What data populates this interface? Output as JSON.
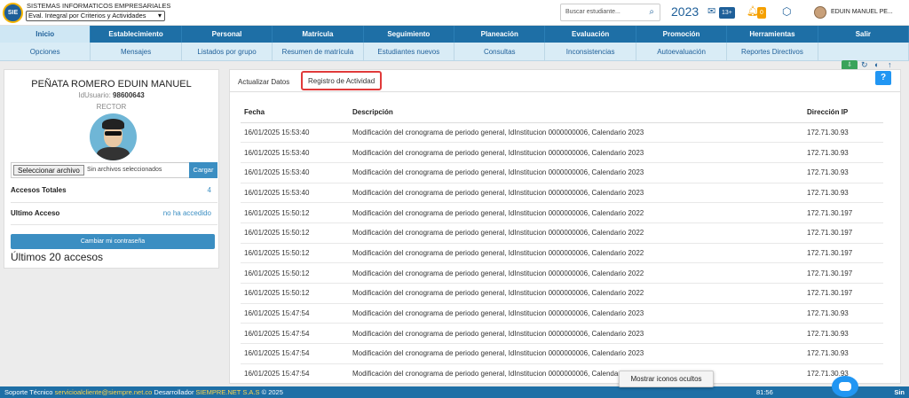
{
  "header": {
    "company": "SISTEMAS INFORMATICOS EMPRESARIALES",
    "logo_text": "SIE",
    "module": "Eval. Integral por Criterios y Actividades",
    "search_placeholder": "Buscar estudiante...",
    "year": "2023",
    "messages_badge": "13+",
    "notifications_badge": "0",
    "user": "EDUIN MANUEL PE..."
  },
  "nav_main": [
    "Inicio",
    "Establecimiento",
    "Personal",
    "Matrícula",
    "Seguimiento",
    "Planeación",
    "Evaluación",
    "Promoción",
    "Herramientas",
    "Salir"
  ],
  "nav_sub": [
    "Opciones",
    "Mensajes",
    "Listados por grupo",
    "Resumen de matrícula",
    "Estudiantes nuevos",
    "Consultas",
    "Inconsistencias",
    "Autoevaluación",
    "Reportes Directivos",
    ""
  ],
  "profile": {
    "name": "PEÑATA ROMERO EDUIN MANUEL",
    "id_label": "IdUsuario:",
    "id_value": "98600643",
    "role": "RECTOR",
    "file_button": "Seleccionar archivo",
    "file_text": "Sin archivos seleccionados",
    "upload_button": "Cargar",
    "total_label": "Accesos Totales",
    "total_value": "4",
    "last_label": "Ultimo Acceso",
    "last_value": "no ha accedido",
    "change_password": "Cambiar mi contraseña",
    "last_accesses": "Últimos 20 accesos"
  },
  "tabs": {
    "update": "Actualizar Datos",
    "activity": "Registro de Actividad"
  },
  "help_label": "?",
  "table": {
    "headers": [
      "Fecha",
      "Descripción",
      "Dirección IP"
    ],
    "rows": [
      [
        "16/01/2025 15:53:40",
        "Modificación del cronograma de periodo general, IdInstitucion 0000000006, Calendario 2023",
        "172.71.30.93"
      ],
      [
        "16/01/2025 15:53:40",
        "Modificación del cronograma de periodo general, IdInstitucion 0000000006, Calendario 2023",
        "172.71.30.93"
      ],
      [
        "16/01/2025 15:53:40",
        "Modificación del cronograma de periodo general, IdInstitucion 0000000006, Calendario 2023",
        "172.71.30.93"
      ],
      [
        "16/01/2025 15:53:40",
        "Modificación del cronograma de periodo general, IdInstitucion 0000000006, Calendario 2023",
        "172.71.30.93"
      ],
      [
        "16/01/2025 15:50:12",
        "Modificación del cronograma de periodo general, IdInstitucion 0000000006, Calendario 2022",
        "172.71.30.197"
      ],
      [
        "16/01/2025 15:50:12",
        "Modificación del cronograma de periodo general, IdInstitucion 0000000006, Calendario 2022",
        "172.71.30.197"
      ],
      [
        "16/01/2025 15:50:12",
        "Modificación del cronograma de periodo general, IdInstitucion 0000000006, Calendario 2022",
        "172.71.30.197"
      ],
      [
        "16/01/2025 15:50:12",
        "Modificación del cronograma de periodo general, IdInstitucion 0000000006, Calendario 2022",
        "172.71.30.197"
      ],
      [
        "16/01/2025 15:50:12",
        "Modificación del cronograma de periodo general, IdInstitucion 0000000006, Calendario 2022",
        "172.71.30.197"
      ],
      [
        "16/01/2025 15:47:54",
        "Modificación del cronograma de periodo general, IdInstitucion 0000000006, Calendario 2023",
        "172.71.30.93"
      ],
      [
        "16/01/2025 15:47:54",
        "Modificación del cronograma de periodo general, IdInstitucion 0000000006, Calendario 2023",
        "172.71.30.93"
      ],
      [
        "16/01/2025 15:47:54",
        "Modificación del cronograma de periodo general, IdInstitucion 0000000006, Calendario 2023",
        "172.71.30.93"
      ],
      [
        "16/01/2025 15:47:54",
        "Modificación del cronograma de periodo general, IdInstitucion 0000000006, Calendario 2023",
        "172.71.30.93"
      ]
    ]
  },
  "footer": {
    "support": "Soporte Técnico",
    "email": "servicioalcliente@siempre.net.co",
    "dev": "Desarrollador",
    "company": "SIEMPRE.NET S.A.S",
    "copy": "© 2025",
    "time": "81:56",
    "sin": "Sin"
  },
  "tooltip": "Mostrar iconos ocultos",
  "icons": [
    "search-icon",
    "mail-icon",
    "bell-icon",
    "cube-icon",
    "refresh-icon",
    "info-icon",
    "arrow-up-icon",
    "chat-icon"
  ],
  "colors": {
    "primary": "#1e6fa6",
    "accent": "#3b8ec2",
    "highlight": "#e03a3a",
    "warning": "#f5a000"
  }
}
